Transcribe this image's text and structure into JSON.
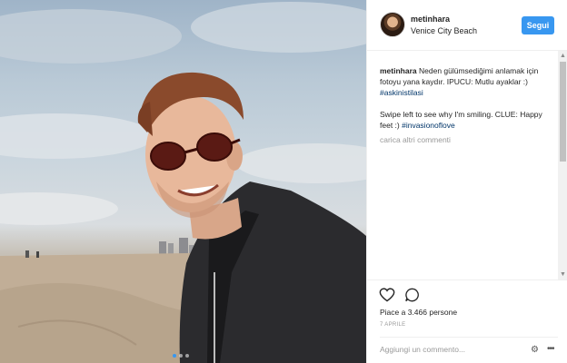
{
  "post": {
    "username": "metinhara",
    "location": "Venice City Beach",
    "follow_label": "Segui",
    "caption_user": "metinhara",
    "caption_text": "Neden gülümsediğimi anlamak için fotoyu yana kaydır. IPUCU: Mutlu ayaklar :)",
    "caption_hashtag": "#askinistilasi",
    "english_text": "Swipe left to see why I'm smiling. CLUE: Happy feet :)",
    "english_hashtag": "#invasionoflove",
    "load_more": "carica altri commenti",
    "likes": "Piace a 3.466 persone",
    "date": "7 APRILE",
    "comment_placeholder": "Aggiungi un commento..."
  },
  "icons": {
    "like": "heart-outline-icon",
    "comment": "speech-bubble-icon",
    "settings": "gear-icon",
    "more": "more-dots-icon"
  },
  "colors": {
    "accent": "#3897f0",
    "hashtag": "#003569",
    "muted": "#999999"
  }
}
